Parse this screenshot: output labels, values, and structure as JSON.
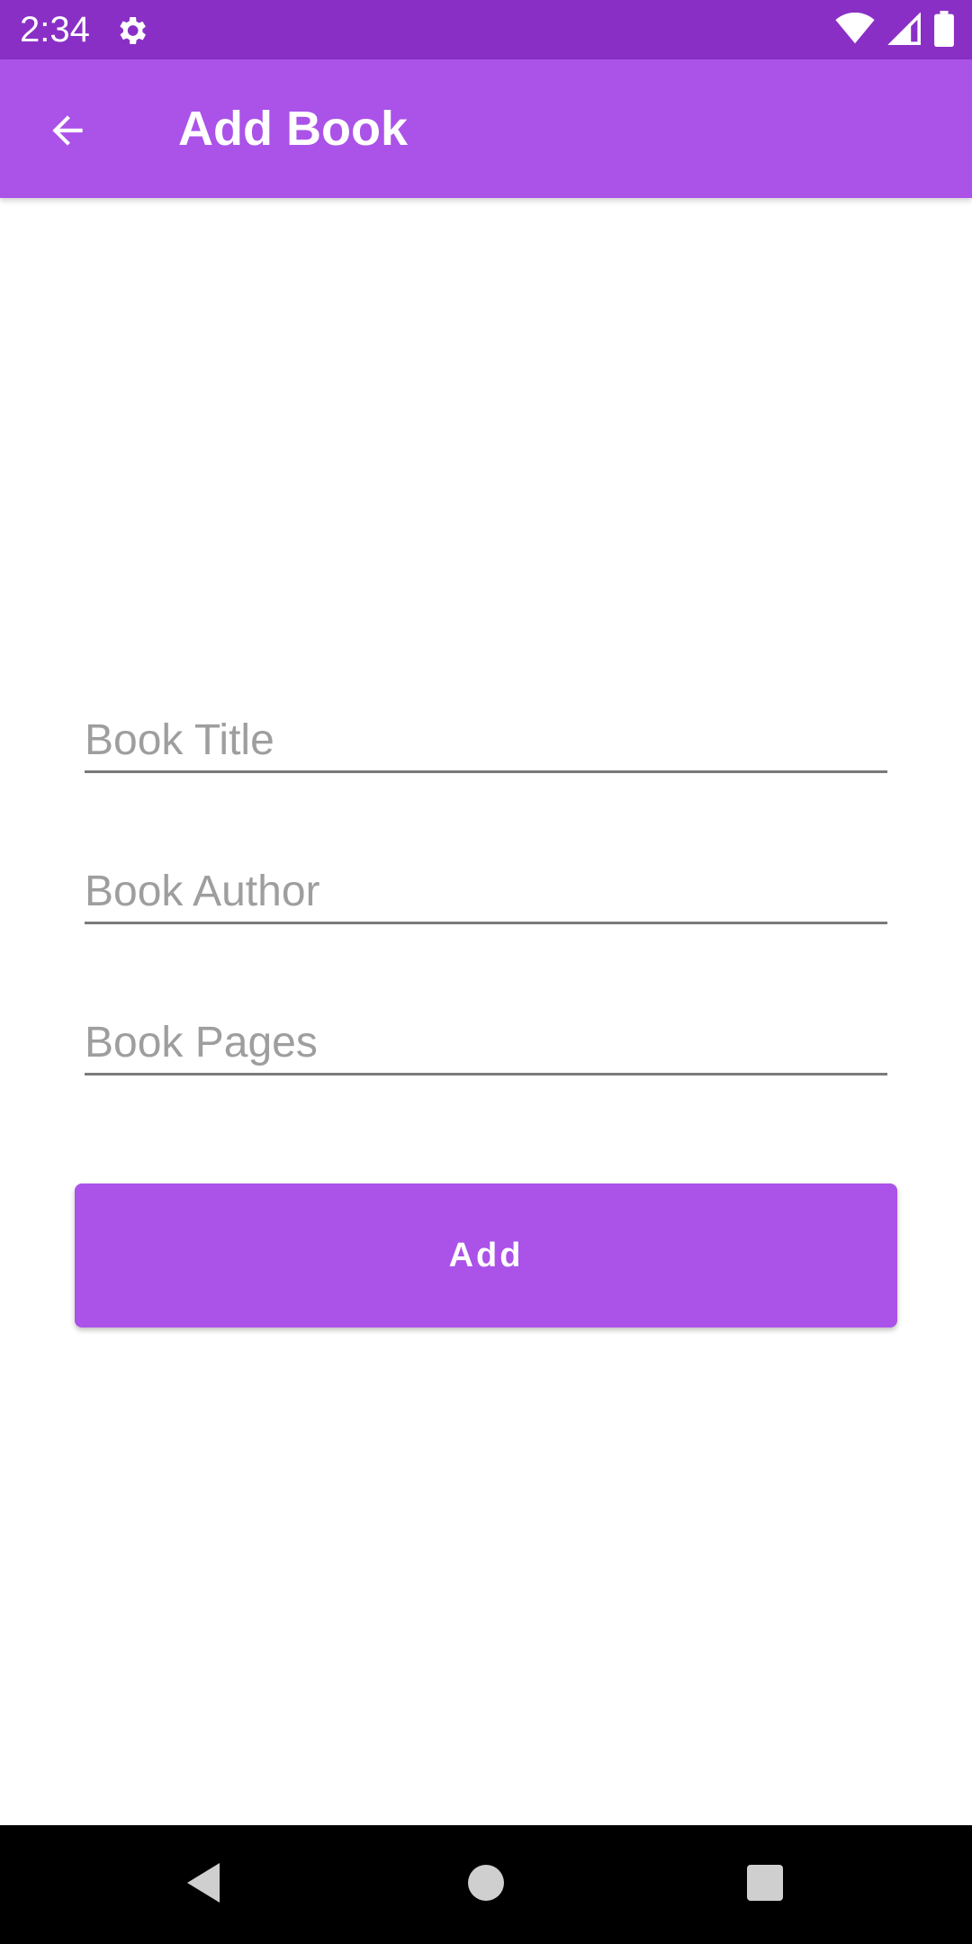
{
  "status_bar": {
    "time": "2:34",
    "icons": [
      "settings-gear-icon",
      "wifi-icon",
      "cellular-signal-icon",
      "battery-icon"
    ]
  },
  "app_bar": {
    "title": "Add Book",
    "back_icon": "arrow-left-icon"
  },
  "form": {
    "book_title": {
      "placeholder": "Book Title",
      "value": ""
    },
    "book_author": {
      "placeholder": "Book Author",
      "value": ""
    },
    "book_pages": {
      "placeholder": "Book Pages",
      "value": ""
    },
    "add_label": "Add"
  },
  "nav_bar": {
    "icons": [
      "nav-back-icon",
      "nav-home-icon",
      "nav-recents-icon"
    ]
  },
  "colors": {
    "status_bar": "#8a2fc6",
    "primary": "#ab52e8",
    "underline": "#7a7a7a",
    "placeholder": "#9e9e9e"
  }
}
